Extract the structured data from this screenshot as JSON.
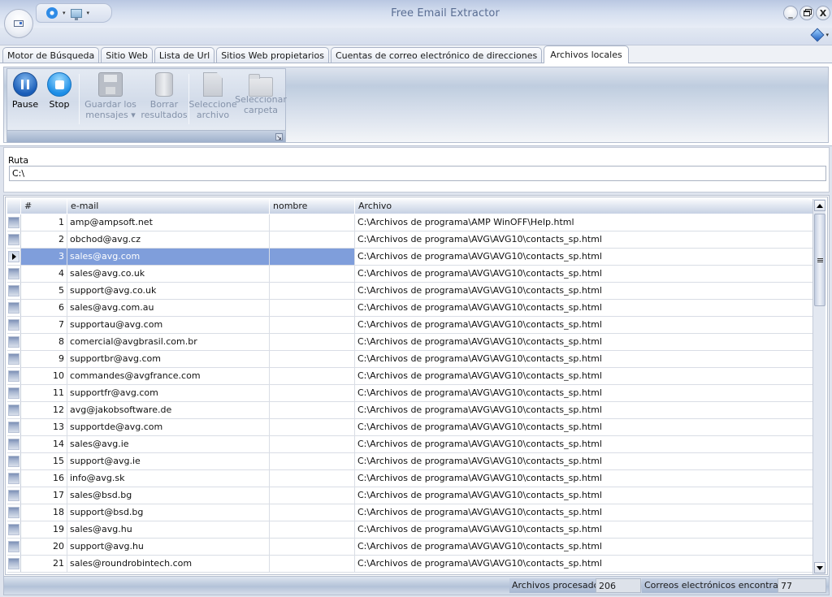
{
  "window": {
    "title": "Free Email Extractor",
    "controls": {
      "minimize": "_",
      "restore": "🗗",
      "close": "X"
    }
  },
  "quick_access": {
    "icons": [
      "gear-icon",
      "monitor-icon"
    ],
    "dropdown_glyph": "▾"
  },
  "help": {
    "icon": "help-diamond-icon",
    "dropdown_glyph": "▾"
  },
  "tabs": [
    {
      "label": "Motor de Búsqueda",
      "active": false
    },
    {
      "label": "Sitio Web",
      "active": false
    },
    {
      "label": "Lista de Url",
      "active": false
    },
    {
      "label": "Sitios Web propietarios",
      "active": false
    },
    {
      "label": "Cuentas de correo electrónico de direcciones",
      "active": false
    },
    {
      "label": "Archivos locales",
      "active": true
    }
  ],
  "toolbar": {
    "pause": {
      "label": "Pause",
      "enabled": true
    },
    "stop": {
      "label": "Stop",
      "enabled": true
    },
    "save": {
      "label_line1": "Guardar los",
      "label_line2": "mensajes ▾",
      "enabled": false
    },
    "clear": {
      "label_line1": "Borrar",
      "label_line2": "resultados",
      "enabled": false
    },
    "select_file": {
      "label_line1": "Seleccione",
      "label_line2": "archivo",
      "enabled": false
    },
    "select_folder": {
      "label_line1": "Seleccionar",
      "label_line2": "carpeta",
      "enabled": false
    },
    "launcher_glyph": "↘"
  },
  "path": {
    "label": "Ruta",
    "value": "C:\\"
  },
  "grid": {
    "columns": [
      "#",
      "e-mail",
      "nombre",
      "Archivo"
    ],
    "selected_row": 3,
    "rows": [
      {
        "num": "1",
        "email": "amp@ampsoft.net",
        "name": "",
        "file": "C:\\Archivos de programa\\AMP WinOFF\\Help.html"
      },
      {
        "num": "2",
        "email": "obchod@avg.cz",
        "name": "",
        "file": "C:\\Archivos de programa\\AVG\\AVG10\\contacts_sp.html"
      },
      {
        "num": "3",
        "email": "sales@avg.com",
        "name": "",
        "file": "C:\\Archivos de programa\\AVG\\AVG10\\contacts_sp.html"
      },
      {
        "num": "4",
        "email": "sales@avg.co.uk",
        "name": "",
        "file": "C:\\Archivos de programa\\AVG\\AVG10\\contacts_sp.html"
      },
      {
        "num": "5",
        "email": "support@avg.co.uk",
        "name": "",
        "file": "C:\\Archivos de programa\\AVG\\AVG10\\contacts_sp.html"
      },
      {
        "num": "6",
        "email": "sales@avg.com.au",
        "name": "",
        "file": "C:\\Archivos de programa\\AVG\\AVG10\\contacts_sp.html"
      },
      {
        "num": "7",
        "email": "supportau@avg.com",
        "name": "",
        "file": "C:\\Archivos de programa\\AVG\\AVG10\\contacts_sp.html"
      },
      {
        "num": "8",
        "email": "comercial@avgbrasil.com.br",
        "name": "",
        "file": "C:\\Archivos de programa\\AVG\\AVG10\\contacts_sp.html"
      },
      {
        "num": "9",
        "email": "supportbr@avg.com",
        "name": "",
        "file": "C:\\Archivos de programa\\AVG\\AVG10\\contacts_sp.html"
      },
      {
        "num": "10",
        "email": "commandes@avgfrance.com",
        "name": "",
        "file": "C:\\Archivos de programa\\AVG\\AVG10\\contacts_sp.html"
      },
      {
        "num": "11",
        "email": "supportfr@avg.com",
        "name": "",
        "file": "C:\\Archivos de programa\\AVG\\AVG10\\contacts_sp.html"
      },
      {
        "num": "12",
        "email": "avg@jakobsoftware.de",
        "name": "",
        "file": "C:\\Archivos de programa\\AVG\\AVG10\\contacts_sp.html"
      },
      {
        "num": "13",
        "email": "supportde@avg.com",
        "name": "",
        "file": "C:\\Archivos de programa\\AVG\\AVG10\\contacts_sp.html"
      },
      {
        "num": "14",
        "email": "sales@avg.ie",
        "name": "",
        "file": "C:\\Archivos de programa\\AVG\\AVG10\\contacts_sp.html"
      },
      {
        "num": "15",
        "email": "support@avg.ie",
        "name": "",
        "file": "C:\\Archivos de programa\\AVG\\AVG10\\contacts_sp.html"
      },
      {
        "num": "16",
        "email": "info@avg.sk",
        "name": "",
        "file": "C:\\Archivos de programa\\AVG\\AVG10\\contacts_sp.html"
      },
      {
        "num": "17",
        "email": "sales@bsd.bg",
        "name": "",
        "file": "C:\\Archivos de programa\\AVG\\AVG10\\contacts_sp.html"
      },
      {
        "num": "18",
        "email": "support@bsd.bg",
        "name": "",
        "file": "C:\\Archivos de programa\\AVG\\AVG10\\contacts_sp.html"
      },
      {
        "num": "19",
        "email": "sales@avg.hu",
        "name": "",
        "file": "C:\\Archivos de programa\\AVG\\AVG10\\contacts_sp.html"
      },
      {
        "num": "20",
        "email": "support@avg.hu",
        "name": "",
        "file": "C:\\Archivos de programa\\AVG\\AVG10\\contacts_sp.html"
      },
      {
        "num": "21",
        "email": "sales@roundrobintech.com",
        "name": "",
        "file": "C:\\Archivos de programa\\AVG\\AVG10\\contacts_sp.html"
      }
    ]
  },
  "status": {
    "files_label": "Archivos procesados",
    "files_value": "206",
    "emails_label": "Correos electrónicos encontrados",
    "emails_value": "77"
  },
  "colors": {
    "selection": "#7f9edb",
    "title_text": "#5a6e93",
    "accent_blue": "#1a5db8"
  }
}
